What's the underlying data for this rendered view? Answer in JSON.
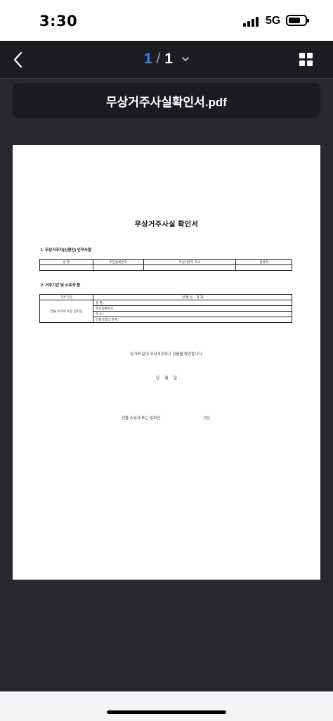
{
  "status_bar": {
    "time": "3:30",
    "network": "5G"
  },
  "nav": {
    "current_page": "1",
    "separator": "/",
    "total_pages": "1"
  },
  "file": {
    "name": "무상거주사실확인서.pdf"
  },
  "document": {
    "title": "무상거주사실 확인서",
    "section1": {
      "heading": "1. 무상거주자(신청인) 인적사항",
      "headers": [
        "성 명",
        "주민등록번호",
        "무상거주지 주소",
        "연락처"
      ]
    },
    "section2": {
      "heading": "2. 거주기간 및 소유자 등",
      "period_label": "거주기간",
      "period_value": "년   월   일 ~ 현 재",
      "owner_label": "건물 소유자 또는 임차인",
      "owner_fields": [
        "성 명 :",
        "주민등록번호 :",
        "주 소 :",
        "신청인과의 관계 :"
      ]
    },
    "confirm_text": "상기와 같이 무상거주하고 있음을 확인합니다.",
    "date_line": "년     월     일",
    "signature_label": "건물 소유자 또는 임차인",
    "seal": "(인)"
  }
}
